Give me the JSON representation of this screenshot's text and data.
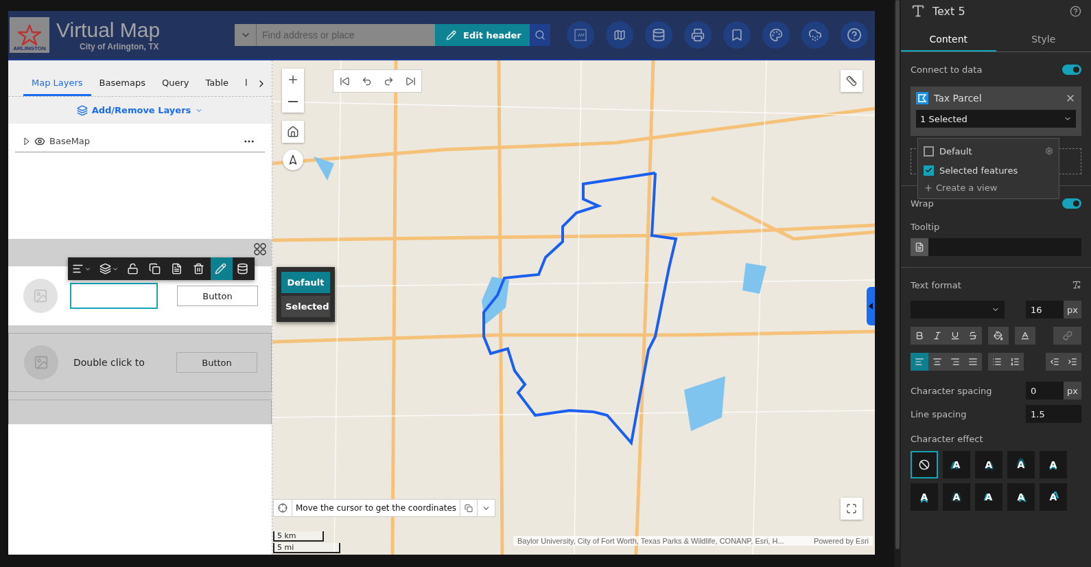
{
  "header": {
    "logo_text": "ARLINGTON",
    "title": "Virtual Map",
    "subtitle": "City of Arlington, TX",
    "search": {
      "placeholder": "Find address or place"
    },
    "edit_button": "Edit header"
  },
  "left_panel": {
    "tabs": [
      {
        "label": "Map Layers",
        "selected": true
      },
      {
        "label": "Basemaps",
        "selected": false
      },
      {
        "label": "Query",
        "selected": false
      },
      {
        "label": "Table",
        "selected": false
      },
      {
        "label": "l",
        "selected": false
      }
    ],
    "add_layers": "Add/Remove Layers",
    "layers": [
      {
        "name": "BaseMap",
        "expanded": false,
        "visible": true
      }
    ],
    "list_items": [
      {
        "button": "Button",
        "selected": true
      },
      {
        "text": "Double click to",
        "button": "Button",
        "selected": false
      }
    ],
    "state_menu": [
      {
        "label": "Default",
        "selected": true
      },
      {
        "label": "Selected",
        "selected": false
      }
    ]
  },
  "map": {
    "coordinates": "Move the cursor to get the coordinates",
    "scale": [
      "5 km",
      "5 mi"
    ],
    "attribution": "Baylor University, City of Fort Worth, Texas Parks & Wildlife, CONANP, Esri, H...",
    "powered_by": "Powered by Esri"
  },
  "right_panel": {
    "title": "Text 5",
    "tabs": [
      {
        "label": "Content",
        "selected": true
      },
      {
        "label": "Style",
        "selected": false
      }
    ],
    "connect_label": "Connect to data",
    "connect_on": true,
    "data_source": {
      "name": "Tax Parcel",
      "select": "1 Selected"
    },
    "views": [
      {
        "label": "Default",
        "checked": false
      },
      {
        "label": "Selected features",
        "checked": true
      }
    ],
    "create_view": "Create a view",
    "wrap_label": "Wrap",
    "wrap_on": true,
    "tooltip_label": "Tooltip",
    "text_format_label": "Text format",
    "font_size": "16",
    "font_unit": "px",
    "align": [
      {
        "kind": "left",
        "selected": true
      },
      {
        "kind": "center",
        "selected": false
      },
      {
        "kind": "right",
        "selected": false
      },
      {
        "kind": "justify",
        "selected": false
      }
    ],
    "char_spacing_label": "Character spacing",
    "char_spacing": "0",
    "char_spacing_unit": "px",
    "line_spacing_label": "Line spacing",
    "line_spacing": "1.5",
    "effect_label": "Character effect",
    "effects": [
      {
        "kind": "none",
        "selected": true
      },
      {
        "kind": "effect",
        "text": "A",
        "selected": false
      },
      {
        "kind": "effect",
        "text": "A",
        "selected": false
      },
      {
        "kind": "effect",
        "text": "A",
        "selected": false
      },
      {
        "kind": "effect",
        "text": "A",
        "selected": false
      },
      {
        "kind": "effect",
        "text": "A",
        "selected": false
      },
      {
        "kind": "effect",
        "text": "A",
        "selected": false
      },
      {
        "kind": "effect",
        "text": "A",
        "selected": false
      },
      {
        "kind": "effect",
        "text": "A",
        "selected": false
      },
      {
        "kind": "effect",
        "text": "A",
        "selected": false
      }
    ]
  }
}
